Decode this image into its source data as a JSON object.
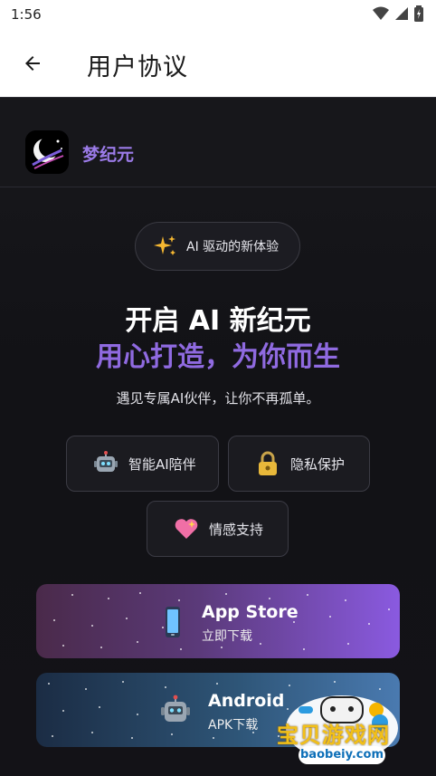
{
  "status_bar": {
    "time": "1:56"
  },
  "app_bar": {
    "title": "用户协议"
  },
  "brand": {
    "name": "梦纪元"
  },
  "pill": {
    "text": "AI 驱动的新体验"
  },
  "hero": {
    "line1": "开启 AI 新纪元",
    "line2": "用心打造，为你而生",
    "subtitle": "遇见专属AI伙伴，让你不再孤单。"
  },
  "features": [
    {
      "label": "智能AI陪伴",
      "icon": "robot-icon"
    },
    {
      "label": "隐私保护",
      "icon": "lock-icon"
    },
    {
      "label": "情感支持",
      "icon": "heart-icon"
    }
  ],
  "downloads": {
    "appstore": {
      "title": "App Store",
      "subtitle": "立即下载",
      "icon": "phone-icon"
    },
    "android": {
      "title": "Android",
      "subtitle": "APK下载",
      "icon": "robot-icon"
    }
  },
  "watermark": {
    "text": "宝贝游戏网",
    "url": "baobeiy.com"
  },
  "colors": {
    "accent": "#8f6ae0",
    "brand": "#9b7be8",
    "background": "#121216"
  }
}
